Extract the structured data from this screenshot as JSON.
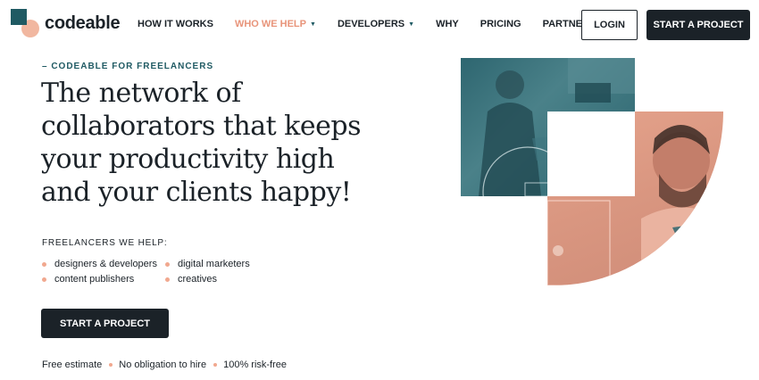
{
  "brand": {
    "name": "codeable"
  },
  "nav": {
    "items": [
      {
        "label": "HOW IT WORKS",
        "dropdown": false,
        "active": false
      },
      {
        "label": "WHO WE HELP",
        "dropdown": true,
        "active": true
      },
      {
        "label": "DEVELOPERS",
        "dropdown": true,
        "active": false
      },
      {
        "label": "WHY",
        "dropdown": false,
        "active": false
      },
      {
        "label": "PRICING",
        "dropdown": false,
        "active": false
      },
      {
        "label": "PARTNERS",
        "dropdown": true,
        "active": false
      }
    ]
  },
  "header": {
    "login_label": "LOGIN",
    "start_label": "START A PROJECT"
  },
  "hero": {
    "eyebrow": "– CODEABLE FOR FREELANCERS",
    "headline": "The network of collaborators that keeps your productivity high and your clients happy!",
    "help_title": "FREELANCERS WE HELP:",
    "help_items": [
      "designers & developers",
      "digital marketers",
      "content publishers",
      "creatives"
    ],
    "cta_label": "START A PROJECT",
    "footnotes": [
      "Free estimate",
      "No obligation to hire",
      "100% risk-free"
    ]
  },
  "colors": {
    "accent_teal": "#1f5a63",
    "accent_peach": "#f1b7a0",
    "active_nav": "#e8947a",
    "dark": "#1b2228"
  }
}
